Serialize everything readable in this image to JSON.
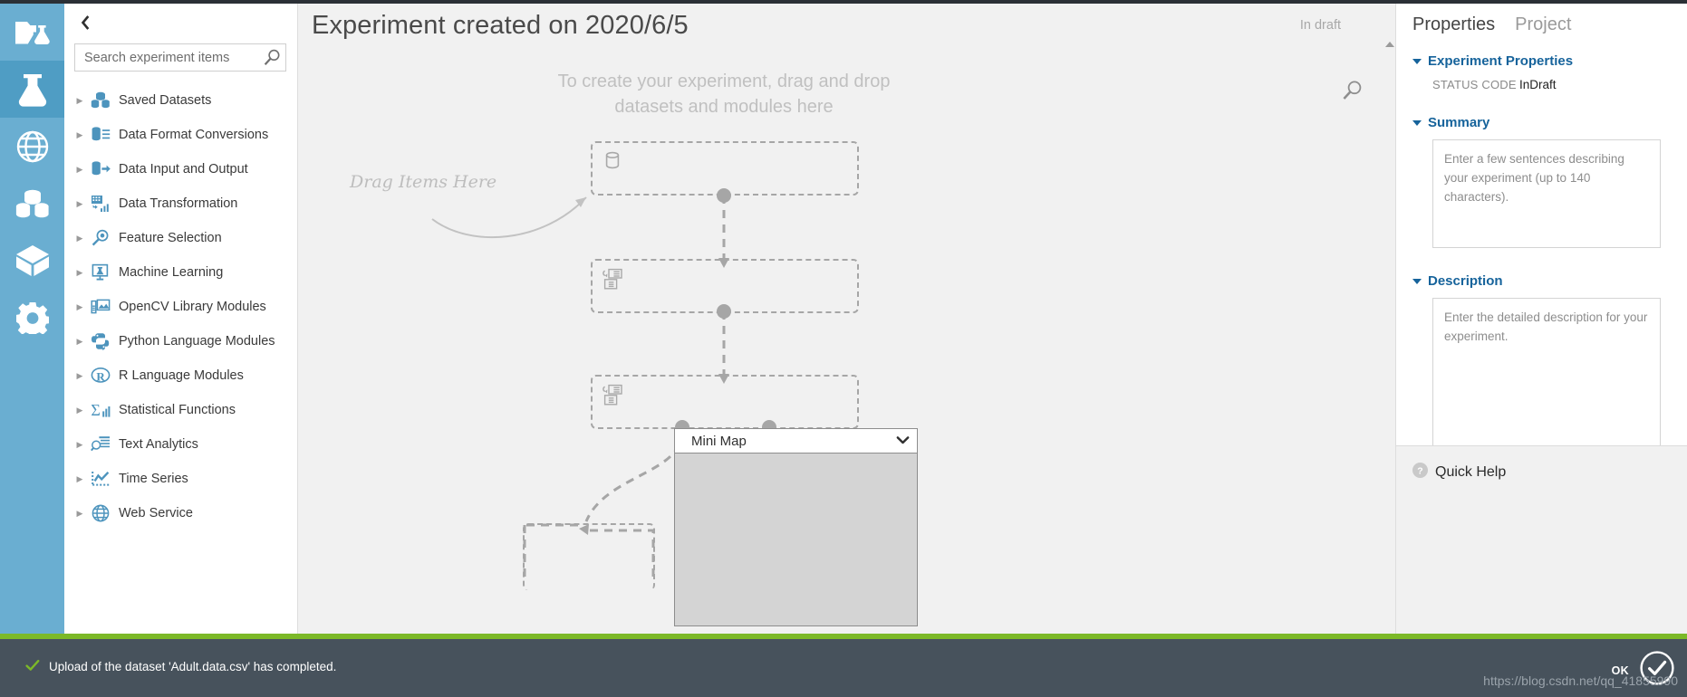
{
  "rail": {
    "items": [
      {
        "name": "projects",
        "icon": "folder-flask-icon",
        "active": false
      },
      {
        "name": "experiments",
        "icon": "flask-icon",
        "active": true
      },
      {
        "name": "web-services",
        "icon": "globe-icon",
        "active": false
      },
      {
        "name": "datasets",
        "icon": "datasets-icon",
        "active": false
      },
      {
        "name": "trained-models",
        "icon": "cube-icon",
        "active": false
      },
      {
        "name": "settings",
        "icon": "gear-icon",
        "active": false
      }
    ]
  },
  "palette": {
    "collapse_label": "‹",
    "search": {
      "placeholder": "Search experiment items",
      "value": "",
      "icon": "search-icon"
    },
    "items": [
      {
        "label": "Saved Datasets",
        "icon": "datasets-icon"
      },
      {
        "label": "Data Format Conversions",
        "icon": "data-format-icon"
      },
      {
        "label": "Data Input and Output",
        "icon": "data-io-icon"
      },
      {
        "label": "Data Transformation",
        "icon": "data-transform-icon"
      },
      {
        "label": "Feature Selection",
        "icon": "feature-selection-icon"
      },
      {
        "label": "Machine Learning",
        "icon": "machine-learning-icon"
      },
      {
        "label": "OpenCV Library Modules",
        "icon": "opencv-icon"
      },
      {
        "label": "Python Language Modules",
        "icon": "python-icon"
      },
      {
        "label": "R Language Modules",
        "icon": "r-lang-icon"
      },
      {
        "label": "Statistical Functions",
        "icon": "statistics-icon"
      },
      {
        "label": "Text Analytics",
        "icon": "text-analytics-icon"
      },
      {
        "label": "Time Series",
        "icon": "time-series-icon"
      },
      {
        "label": "Web Service",
        "icon": "globe-icon"
      }
    ]
  },
  "canvas": {
    "title": "Experiment created on 2020/6/5",
    "status": "In draft",
    "hint": "To create your experiment, drag and drop datasets and modules here",
    "drag_hint": "Drag Items Here",
    "search_icon": "search-icon",
    "minimap": {
      "label": "Mini Map",
      "chevron": "chevron-down-icon"
    }
  },
  "properties": {
    "tabs": [
      {
        "label": "Properties",
        "active": true
      },
      {
        "label": "Project",
        "active": false
      }
    ],
    "experiment_properties": {
      "heading": "Experiment Properties",
      "status_code_key": "STATUS CODE",
      "status_code_value": "InDraft"
    },
    "summary": {
      "heading": "Summary",
      "placeholder": "Enter a few sentences describing your experiment (up to 140 characters).",
      "value": ""
    },
    "description": {
      "heading": "Description",
      "placeholder": "Enter the detailed description for your experiment.",
      "value": ""
    },
    "quick_help": {
      "label": "Quick Help",
      "icon": "help-icon"
    }
  },
  "notification": {
    "message": "Upload of the dataset 'Adult.data.csv' has completed.",
    "status_icon": "check-icon",
    "ok_label": "OK",
    "ok_icon": "check-circle-icon",
    "watermark": "https://blog.csdn.net/qq_41855990"
  },
  "colors": {
    "rail": "#6aaed1",
    "rail_active": "#4f9dc4",
    "accent": "#16639b",
    "green": "#7cb928",
    "notif_bg": "#47525c",
    "canvas_bg": "#f1f1f1"
  }
}
